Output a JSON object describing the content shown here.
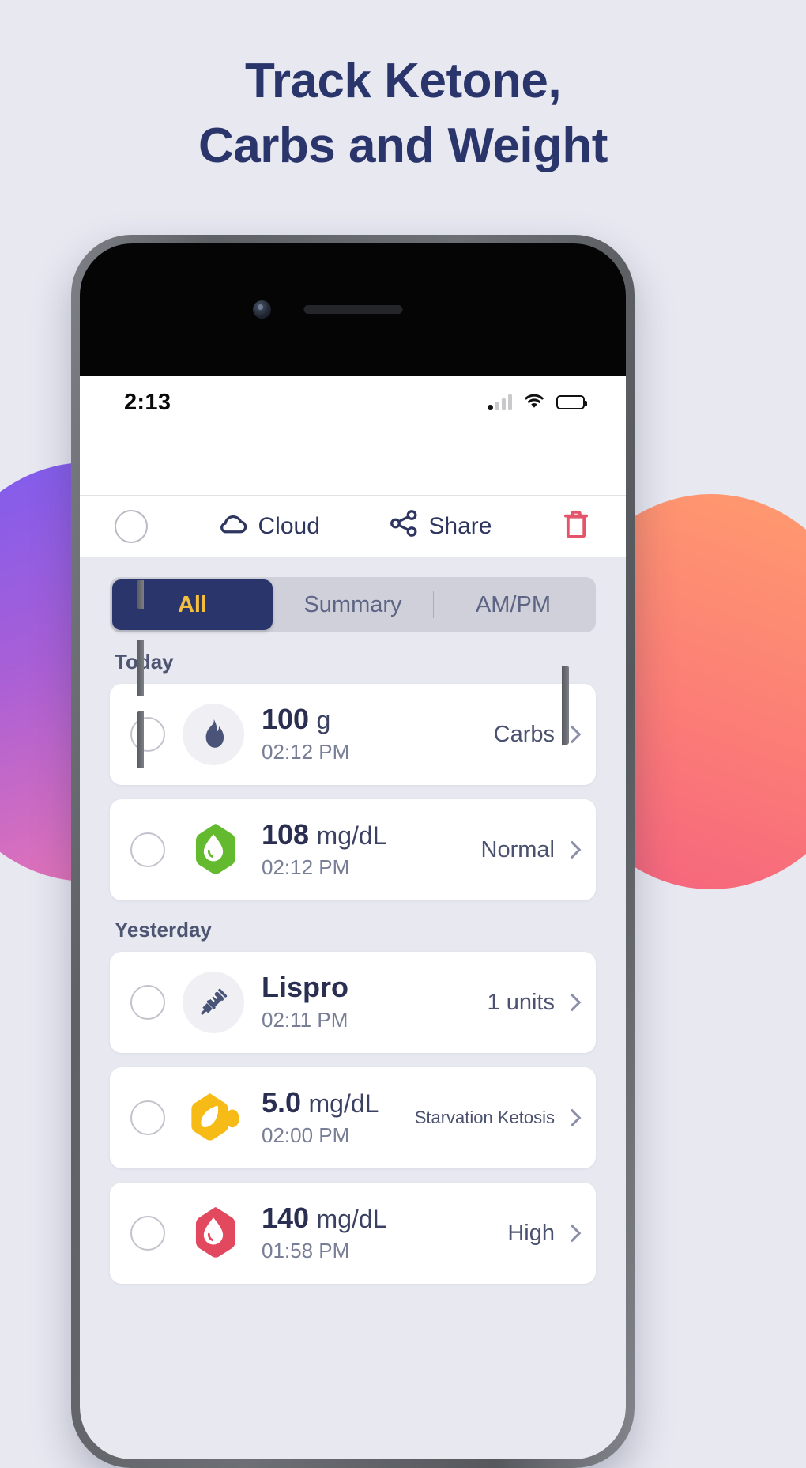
{
  "headline": {
    "line1": "Track Ketone,",
    "line2": "Carbs and Weight",
    "color": "#29356b"
  },
  "status_bar": {
    "time": "2:13",
    "signal_icon": "cellular-signal-icon",
    "wifi_icon": "wifi-icon",
    "battery_icon": "battery-icon"
  },
  "toolbar": {
    "select_all_checkbox": "select-all-circle",
    "cloud_label": "Cloud",
    "share_label": "Share",
    "delete_icon": "trash-icon",
    "delete_color": "#e2556a"
  },
  "segmented_control": {
    "selected": "All",
    "active_bg": "#29356b",
    "active_text_color": "#f4bf3f",
    "tabs": [
      {
        "label": "All",
        "active": true
      },
      {
        "label": "Summary",
        "active": false
      },
      {
        "label": "AM/PM",
        "active": false
      }
    ]
  },
  "sections": [
    {
      "title": "Today",
      "rows": [
        {
          "icon": "flame-icon",
          "icon_style": "circle",
          "icon_bg": "#f0f0f4",
          "icon_color": "#4a5378",
          "value": "100",
          "unit": "g",
          "time": "02:12 PM",
          "status": "Carbs",
          "status_small": false
        },
        {
          "icon": "blood-drop-icon",
          "icon_style": "hexagon",
          "icon_bg": "#63ba2e",
          "icon_color": "#ffffff",
          "value": "108",
          "unit": "mg/dL",
          "time": "02:12 PM",
          "status": "Normal",
          "status_small": false
        }
      ]
    },
    {
      "title": "Yesterday",
      "rows": [
        {
          "icon": "syringe-icon",
          "icon_style": "circle",
          "icon_bg": "#f0f0f4",
          "icon_color": "#4a5378",
          "value": "Lispro",
          "unit": "",
          "time": "02:11 PM",
          "status": "1 units",
          "status_small": false
        },
        {
          "icon": "ketone-icon",
          "icon_style": "hexagon",
          "icon_bg": "#f7bb17",
          "icon_color": "#ffffff",
          "value": "5.0",
          "unit": "mg/dL",
          "time": "02:00 PM",
          "status": "Starvation Ketosis",
          "status_small": true
        },
        {
          "icon": "blood-drop-icon",
          "icon_style": "hexagon",
          "icon_bg": "#e2495e",
          "icon_color": "#ffffff",
          "value": "140",
          "unit": "mg/dL",
          "time": "01:58 PM",
          "status": "High",
          "status_small": false
        }
      ]
    }
  ]
}
